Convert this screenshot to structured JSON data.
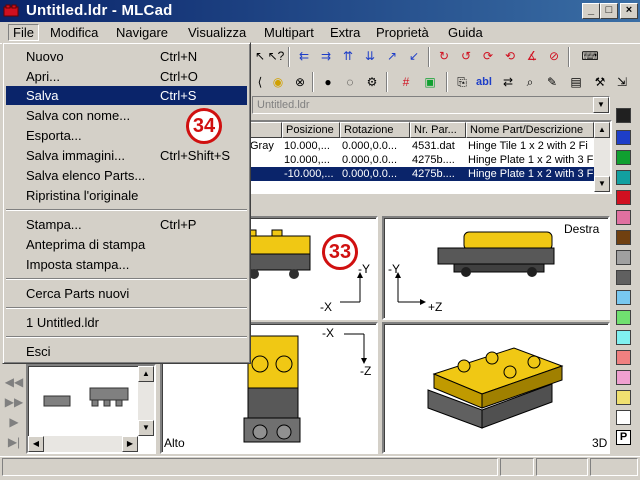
{
  "window": {
    "title": "Untitled.ldr - MLCad"
  },
  "menubar": [
    "File",
    "Modifica",
    "Navigare",
    "Visualizza",
    "Multipart",
    "Extra",
    "Proprietà",
    "Guida"
  ],
  "file_menu": {
    "items": [
      {
        "label": "Nuovo",
        "shortcut": "Ctrl+N"
      },
      {
        "label": "Apri...",
        "shortcut": "Ctrl+O"
      },
      {
        "label": "Salva",
        "shortcut": "Ctrl+S",
        "highlighted": true
      },
      {
        "label": "Salva con nome...",
        "shortcut": ""
      },
      {
        "label": "Esporta...",
        "shortcut": ""
      },
      {
        "label": "Salva immagini...",
        "shortcut": "Ctrl+Shift+S"
      },
      {
        "label": "Salva elenco Parts...",
        "shortcut": ""
      },
      {
        "label": "Ripristina l'originale",
        "shortcut": ""
      },
      {
        "label": "Stampa...",
        "shortcut": "Ctrl+P"
      },
      {
        "label": "Anteprima di stampa",
        "shortcut": ""
      },
      {
        "label": "Imposta stampa...",
        "shortcut": ""
      },
      {
        "label": "Cerca Parts nuovi",
        "shortcut": ""
      },
      {
        "label": "1 Untitled.ldr",
        "shortcut": ""
      },
      {
        "label": "Esci",
        "shortcut": ""
      }
    ]
  },
  "file_combo": {
    "value": "Untitled.ldr"
  },
  "parts_list": {
    "columns": [
      "Posizione",
      "Rotazione",
      "Nr. Par...",
      "Nome Part/Descrizione"
    ],
    "rows": [
      {
        "color": "Gray",
        "position": "10.000,...",
        "rotation": "0.000,0.0...",
        "part": "4531.dat",
        "desc": "Hinge Tile  1 x  2 with 2 Fi",
        "selected": false
      },
      {
        "color": "",
        "position": "10.000,...",
        "rotation": "0.000,0.0...",
        "part": "4275b....",
        "desc": "Hinge Plate  1 x  2 with 3 F",
        "selected": false
      },
      {
        "color": "",
        "position": "-10.000,...",
        "rotation": "0.000,0.0...",
        "part": "4275b....",
        "desc": "Hinge Plate  1 x  2 with 3 F",
        "selected": true
      }
    ]
  },
  "views": {
    "top_left": {
      "label": "",
      "axes": [
        "-Y",
        "-X"
      ]
    },
    "top_right": {
      "label": "Destra",
      "axes": [
        "-Y",
        "+Z"
      ]
    },
    "bottom_left": {
      "label": "Alto",
      "axes": [
        "-X",
        "-Z"
      ]
    },
    "bottom_right": {
      "label": "3D"
    }
  },
  "badges": {
    "b33": "33",
    "b34": "34"
  },
  "palette": {
    "colors": [
      "#202020",
      "#1e3ec8",
      "#10a030",
      "#12a0a0",
      "#d01020",
      "#e070a0",
      "#704010",
      "#a0a0a0",
      "#606060",
      "#78c8f0",
      "#70e070",
      "#80f0f0",
      "#f08080",
      "#f0a0d0",
      "#f0e070",
      "#ffffff"
    ],
    "special_label": "P"
  },
  "toolbar": {
    "row1": [
      "move-left-x",
      "move-right-x",
      "move-up-y",
      "move-down-y",
      "move-z1",
      "move-z2",
      "rotate-x",
      "rotate-y",
      "rotate-z",
      "rotate-free",
      "rotate-reset",
      "keyboard-icon"
    ],
    "row2": [
      "ldraw-icon",
      "noscale-icon",
      "light-icon",
      "bulb-icon",
      "parts-icon",
      "grid-icon",
      "zoom-icon",
      "folder-icon",
      "text-icon",
      "replace-icon",
      "search-icon",
      "edit-icon",
      "image-icon",
      "settings-icon"
    ]
  },
  "statusbar": {
    "text": ""
  }
}
